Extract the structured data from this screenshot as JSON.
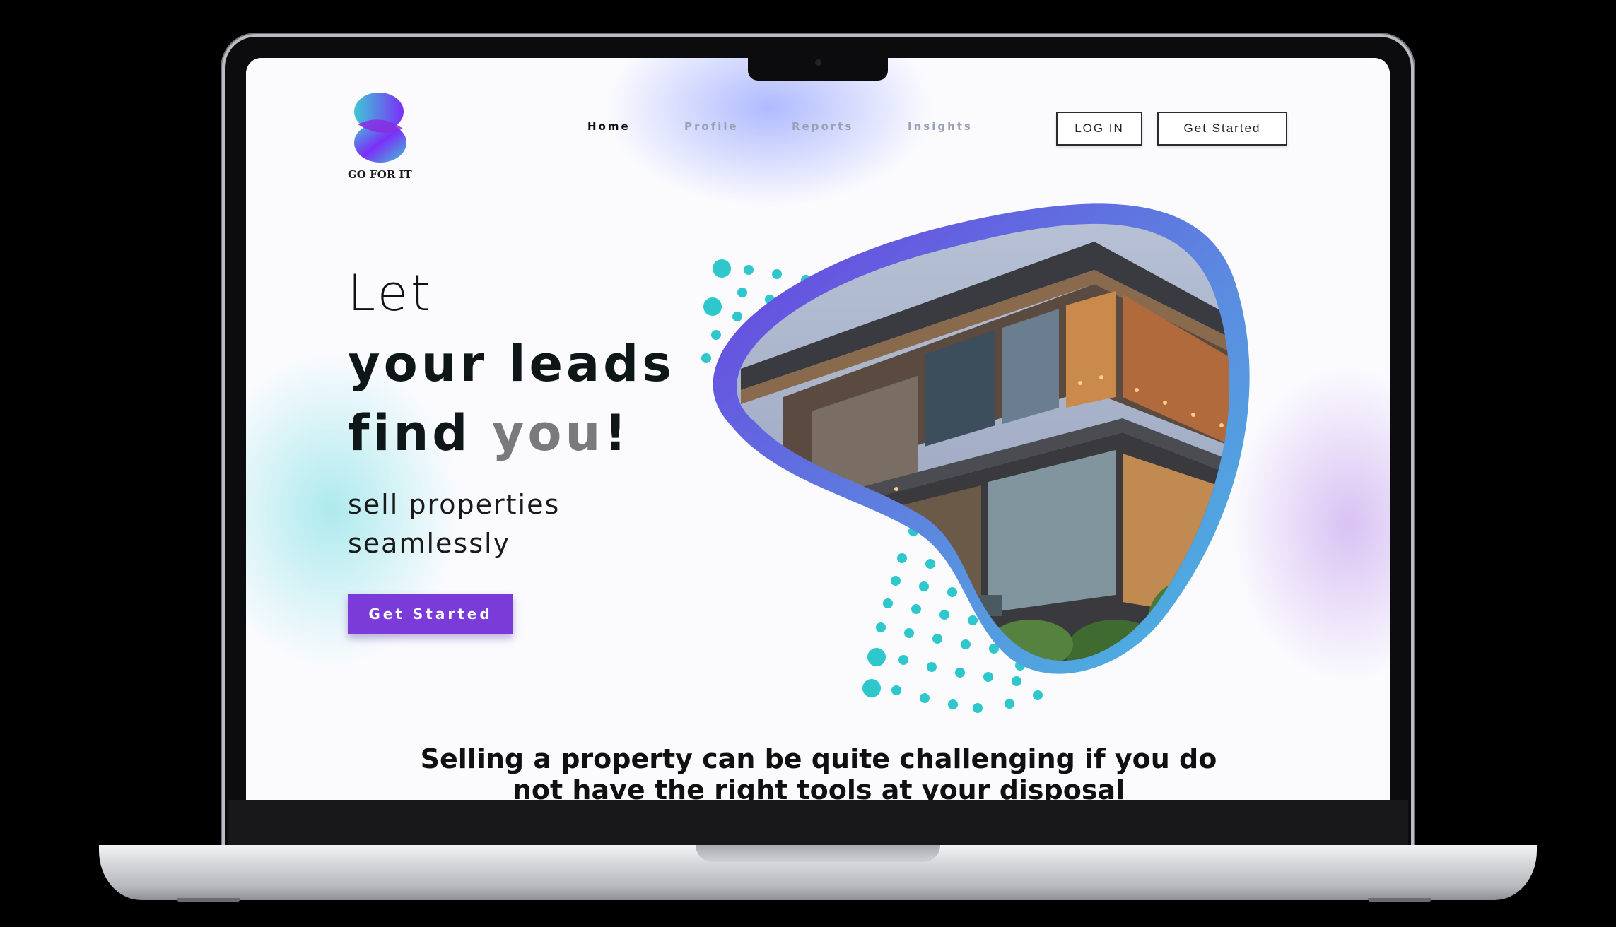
{
  "brand": {
    "name": "GO FOR IT",
    "gradient": [
      "#7b2ff7",
      "#3fc7d6"
    ]
  },
  "nav": {
    "items": [
      {
        "label": "Home",
        "active": true
      },
      {
        "label": "Profile",
        "active": false
      },
      {
        "label": "Reports",
        "active": false
      },
      {
        "label": "Insights",
        "active": false
      }
    ]
  },
  "header": {
    "login_label": "LOG IN",
    "get_started_label": "Get Started"
  },
  "hero": {
    "line1": "Let",
    "line2": "your leads",
    "line3_a": "find ",
    "line3_b": "you",
    "line3_c": "!",
    "subtitle_1": "sell properties",
    "subtitle_2": "seamlessly",
    "cta_label": "Get Started",
    "image_icon": "modern-house-photo",
    "dot_color": "#2ec8cc",
    "frame_gradient": [
      "#7040e0",
      "#50a8e0"
    ]
  },
  "tagline": {
    "text": "Selling a property can be quite challenging if you do not have the right tools at your disposal"
  },
  "colors": {
    "primary": "#7a3bd9",
    "text_dark": "#0e1618",
    "nav_inactive": "#9aa0b6"
  }
}
